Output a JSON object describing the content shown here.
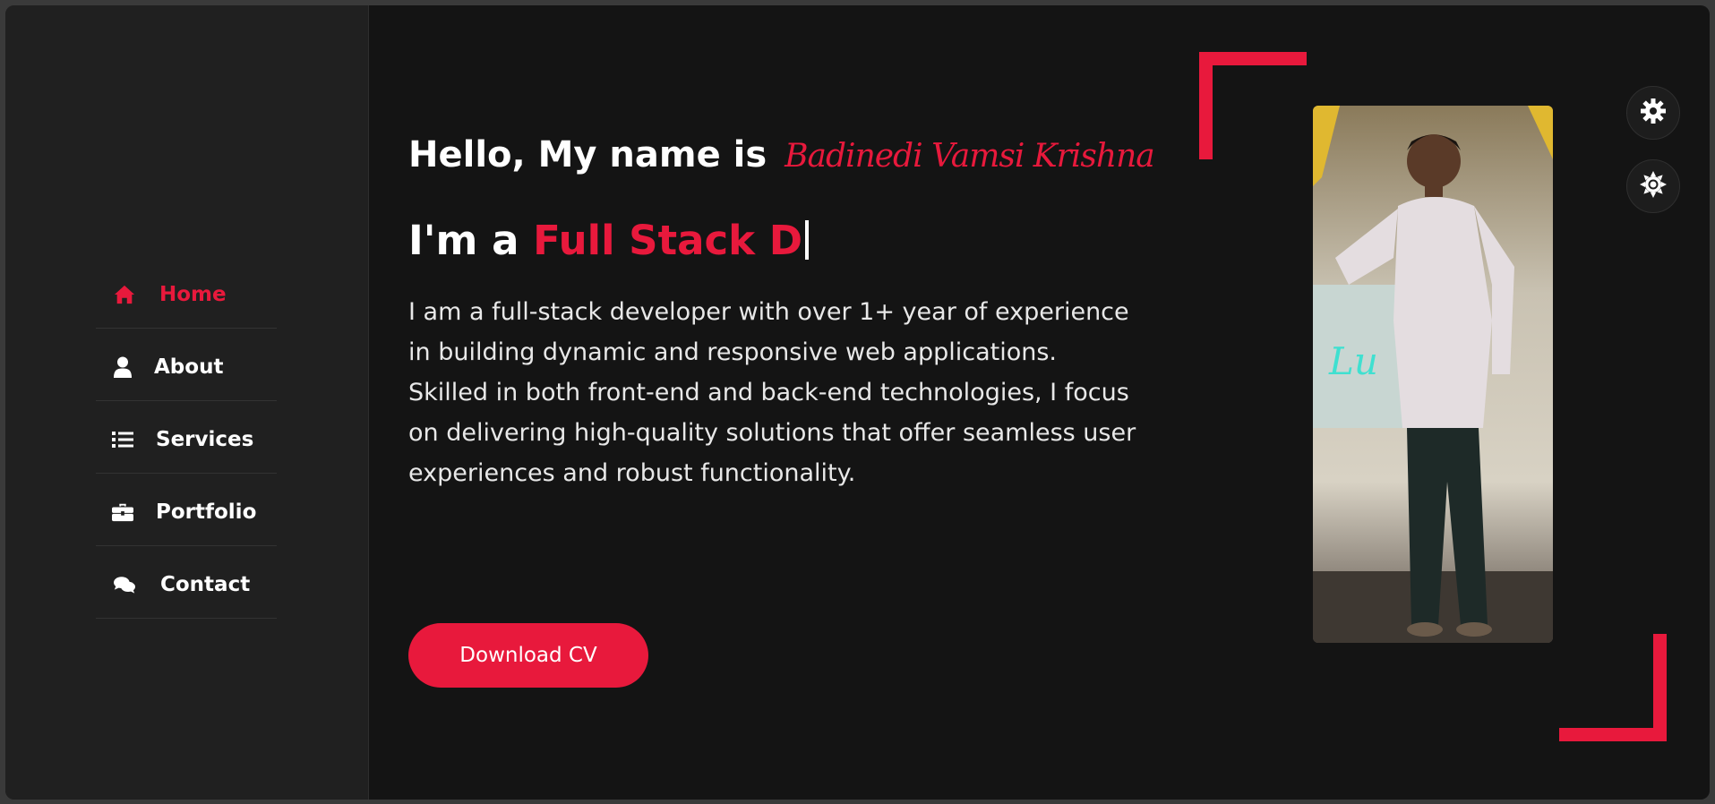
{
  "nav": {
    "items": [
      {
        "label": "Home",
        "icon": "home-icon",
        "active": true
      },
      {
        "label": "About",
        "icon": "user-icon",
        "active": false
      },
      {
        "label": "Services",
        "icon": "list-icon",
        "active": false
      },
      {
        "label": "Portfolio",
        "icon": "briefcase-icon",
        "active": false
      },
      {
        "label": "Contact",
        "icon": "chat-icon",
        "active": false
      }
    ]
  },
  "hero": {
    "greeting": "Hello, My name is",
    "name": "Badinedi Vamsi Krishna",
    "role_prefix": "I'm a",
    "role_typed": "Full Stack D",
    "description": "I am a full-stack developer with over 1+ year of experience in building dynamic and responsive web applications. Skilled in both front-end and back-end technologies, I focus on delivering high-quality solutions that offer seamless user experiences and robust functionality.",
    "cta_label": "Download CV"
  },
  "controls": {
    "settings_icon": "gear-icon",
    "theme_icon": "sun-icon"
  },
  "colors": {
    "accent": "#e8193c",
    "background": "#141414",
    "sidebar": "#202020",
    "text": "#ffffff"
  }
}
